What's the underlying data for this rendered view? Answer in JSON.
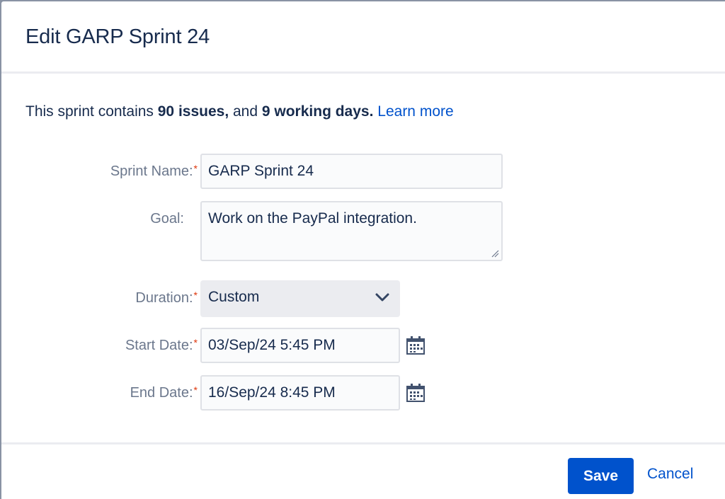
{
  "dialog": {
    "title": "Edit GARP Sprint 24"
  },
  "summary": {
    "prefix": "This sprint contains ",
    "issues": "90 issues,",
    "middle": " and ",
    "days": "9 working days.",
    "learn_more": "Learn more"
  },
  "form": {
    "required_marker": "*",
    "sprint_name": {
      "label": "Sprint Name:",
      "value": "GARP Sprint 24",
      "required": true
    },
    "goal": {
      "label": "Goal:",
      "value": "Work on the PayPal integration.",
      "required": false
    },
    "duration": {
      "label": "Duration:",
      "value": "Custom",
      "required": true
    },
    "start_date": {
      "label": "Start Date:",
      "value": "03/Sep/24 5:45 PM",
      "required": true,
      "icon": "calendar-icon"
    },
    "end_date": {
      "label": "End Date:",
      "value": "16/Sep/24 8:45 PM",
      "required": true,
      "icon": "calendar-icon"
    }
  },
  "footer": {
    "save_label": "Save",
    "cancel_label": "Cancel"
  },
  "colors": {
    "primary": "#0052cc",
    "required": "#de350b",
    "text": "#172b4d",
    "label": "#6b778c"
  }
}
